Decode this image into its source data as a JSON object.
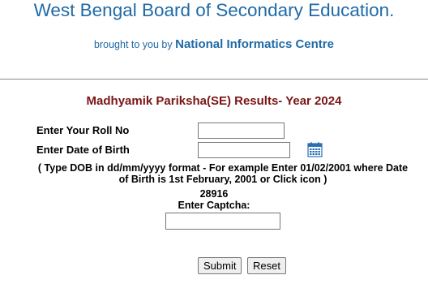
{
  "header": {
    "title": "West Bengal Board of Secondary Education.",
    "brought_prefix": "brought to you by",
    "brought_org": "National Informatics Centre"
  },
  "form": {
    "title": "Madhyamik Pariksha(SE) Results- Year 2024",
    "roll_label": "Enter Your Roll No",
    "roll_value": "",
    "dob_label": "Enter Date of Birth",
    "dob_value": "",
    "dob_hint": "( Type DOB in dd/mm/yyyy format - For example Enter 01/02/2001 where Date of Birth is 1st February, 2001 or Click icon  )",
    "captcha_code": "28916",
    "captcha_label": "Enter Captcha:",
    "captcha_value": "",
    "submit_label": "Submit",
    "reset_label": "Reset"
  },
  "icons": {
    "calendar": "calendar-icon"
  },
  "colors": {
    "header_blue": "#1f6aa6",
    "title_maroon": "#7a1515",
    "calendar_blue": "#2a6fb5"
  }
}
